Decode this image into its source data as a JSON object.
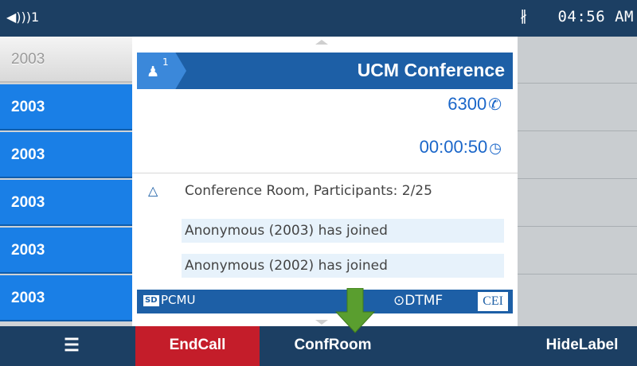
{
  "statusbar": {
    "volume_icon": "speaker-icon",
    "volume_text": "◀)))1",
    "bluetooth_icon": "bluetooth-icon",
    "bluetooth_glyph": "∦",
    "time": "04:56 AM"
  },
  "lines": [
    {
      "label": "2003",
      "state": "selected"
    },
    {
      "label": "2003",
      "state": "normal"
    },
    {
      "label": "2003",
      "state": "normal"
    },
    {
      "label": "2003",
      "state": "normal"
    },
    {
      "label": "2003",
      "state": "normal"
    },
    {
      "label": "2003",
      "state": "normal"
    }
  ],
  "call": {
    "participants_badge": "1",
    "title": "UCM Conference",
    "number": "6300",
    "duration": "00:00:50",
    "room_info": "Conference Room, Participants: 2/25",
    "messages": [
      "Anonymous (2003) has joined",
      "Anonymous (2002) has joined"
    ],
    "codec_badge": "SD",
    "codec": "PCMU",
    "dtmf_glyph": "⊙",
    "dtmf": "DTMF",
    "cei": "CEI"
  },
  "softkeys": {
    "menu_glyph": "☰",
    "endcall": "EndCall",
    "confroom": "ConfRoom",
    "hidelabel": "HideLabel"
  },
  "colors": {
    "bar": "#1c3f63",
    "line_blue": "#1a7fe6",
    "header_blue": "#1d5fa6",
    "end_red": "#c41d2a",
    "arrow_green": "#5a9e2f"
  }
}
